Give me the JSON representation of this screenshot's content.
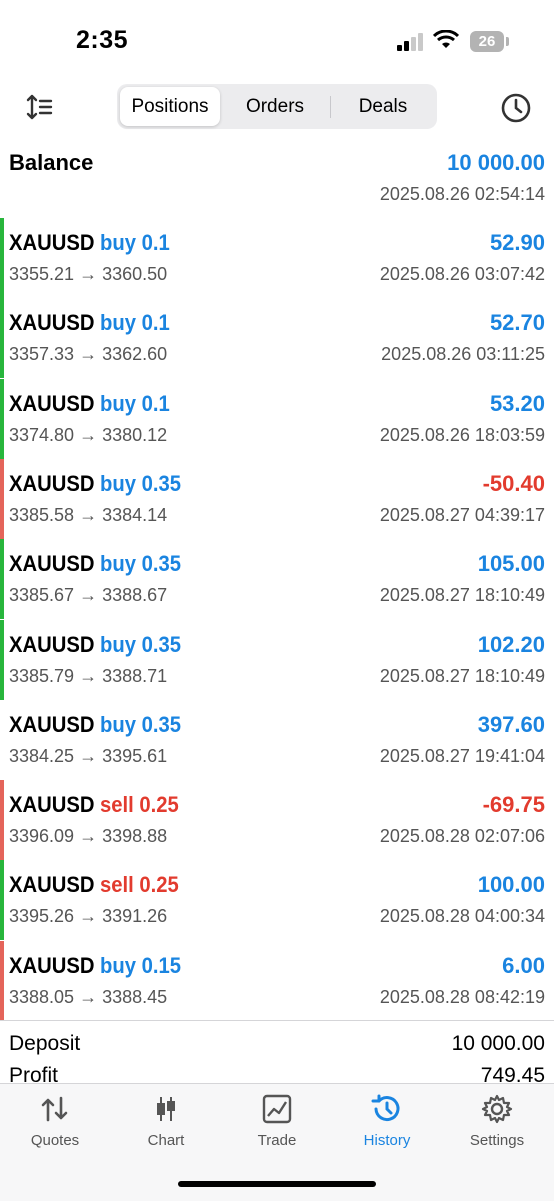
{
  "status_bar": {
    "time": "2:35",
    "battery": "26"
  },
  "toolbar": {
    "tabs": [
      "Positions",
      "Orders",
      "Deals"
    ],
    "active_tab": "Positions"
  },
  "balance": {
    "label": "Balance",
    "amount": "10 000.00",
    "time": "2025.08.26 02:54:14"
  },
  "colors": {
    "accent": "#1a84e0",
    "loss": "#e23b2e",
    "gain_bar": "#28b63c",
    "loss_bar": "#e4645a"
  },
  "trades": [
    {
      "symbol": "XAUUSD",
      "side": "buy 0.1",
      "prices": "3355.21 → 3360.50",
      "profit": "52.90",
      "time": "2025.08.26 03:07:42",
      "result": "gain"
    },
    {
      "symbol": "XAUUSD",
      "side": "buy 0.1",
      "prices": "3357.33 → 3362.60",
      "profit": "52.70",
      "time": "2025.08.26 03:11:25",
      "result": "gain"
    },
    {
      "symbol": "XAUUSD",
      "side": "buy 0.1",
      "prices": "3374.80 → 3380.12",
      "profit": "53.20",
      "time": "2025.08.26 18:03:59",
      "result": "gain"
    },
    {
      "symbol": "XAUUSD",
      "side": "buy 0.35",
      "prices": "3385.58 → 3384.14",
      "profit": "-50.40",
      "time": "2025.08.27 04:39:17",
      "result": "loss"
    },
    {
      "symbol": "XAUUSD",
      "side": "buy 0.35",
      "prices": "3385.67 → 3388.67",
      "profit": "105.00",
      "time": "2025.08.27 18:10:49",
      "result": "gain"
    },
    {
      "symbol": "XAUUSD",
      "side": "buy 0.35",
      "prices": "3385.79 → 3388.71",
      "profit": "102.20",
      "time": "2025.08.27 18:10:49",
      "result": "gain"
    },
    {
      "symbol": "XAUUSD",
      "side": "buy 0.35",
      "prices": "3384.25 → 3395.61",
      "profit": "397.60",
      "time": "2025.08.27 19:41:04",
      "result": "none"
    },
    {
      "symbol": "XAUUSD",
      "side": "sell 0.25",
      "prices": "3396.09 → 3398.88",
      "profit": "-69.75",
      "time": "2025.08.28 02:07:06",
      "result": "loss"
    },
    {
      "symbol": "XAUUSD",
      "side": "sell 0.25",
      "prices": "3395.26 → 3391.26",
      "profit": "100.00",
      "time": "2025.08.28 04:00:34",
      "result": "gain"
    },
    {
      "symbol": "XAUUSD",
      "side": "buy 0.15",
      "prices": "3388.05 → 3388.45",
      "profit": "6.00",
      "time": "2025.08.28 08:42:19",
      "result": "loss"
    }
  ],
  "summary": {
    "deposit_label": "Deposit",
    "deposit": "10 000.00",
    "profit_label": "Profit",
    "profit": "749.45"
  },
  "tabbar": [
    {
      "label": "Quotes",
      "icon": "quotes-icon"
    },
    {
      "label": "Chart",
      "icon": "candlestick-icon"
    },
    {
      "label": "Trade",
      "icon": "trade-chart-icon"
    },
    {
      "label": "History",
      "icon": "history-icon",
      "active": true
    },
    {
      "label": "Settings",
      "icon": "gear-icon"
    }
  ]
}
